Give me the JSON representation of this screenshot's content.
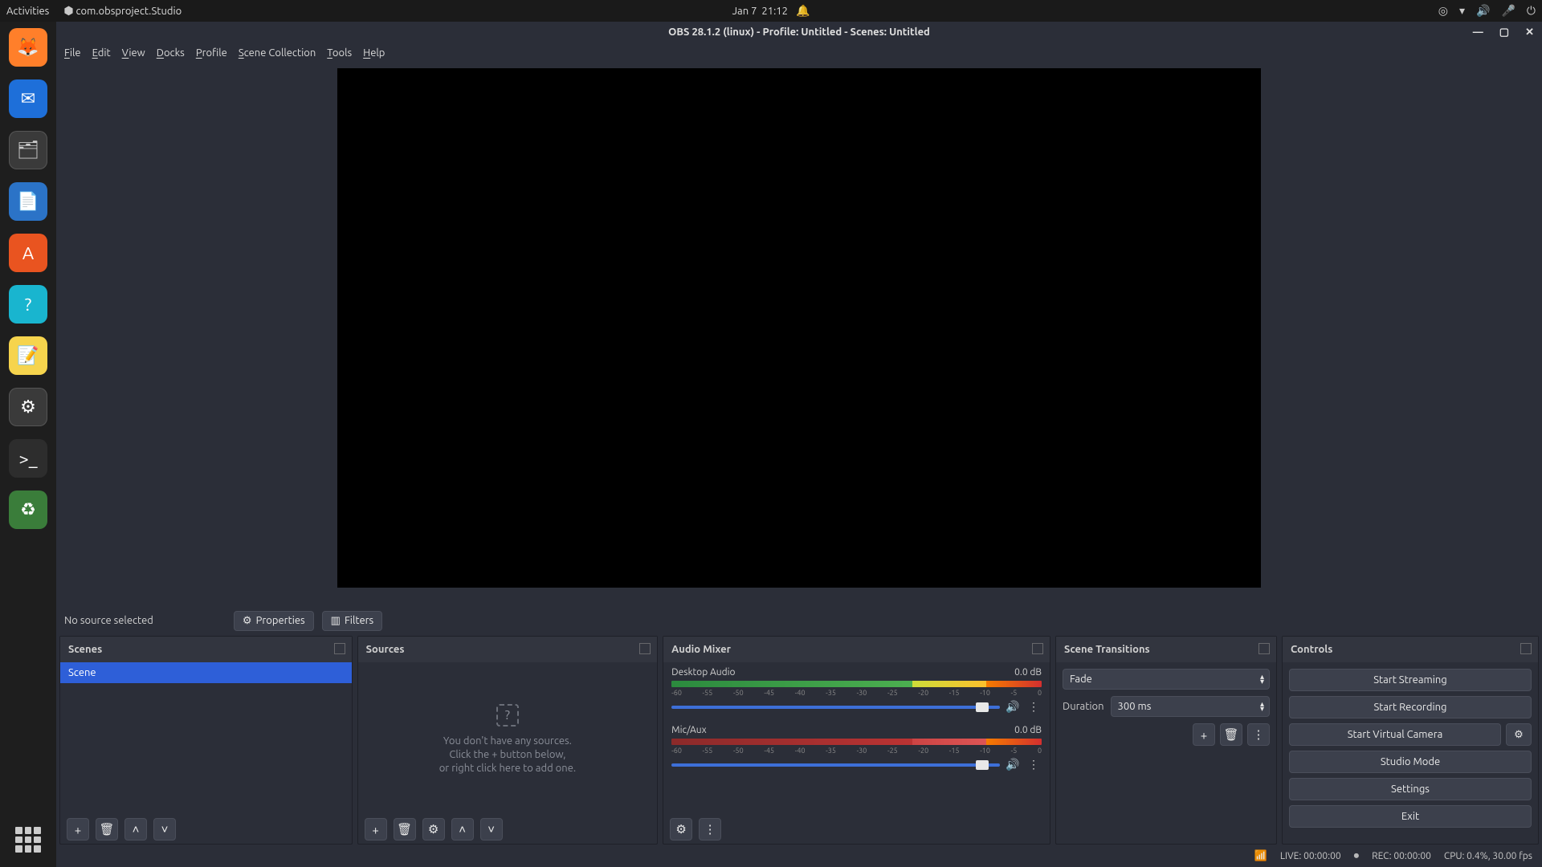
{
  "topbar": {
    "activities": "Activities",
    "app": "com.obsproject.Studio",
    "date": "Jan 7",
    "time": "21:12"
  },
  "window": {
    "title": "OBS 28.1.2 (linux) - Profile: Untitled - Scenes: Untitled"
  },
  "menubar": [
    "File",
    "Edit",
    "View",
    "Docks",
    "Profile",
    "Scene Collection",
    "Tools",
    "Help"
  ],
  "srcinfo": {
    "no_source": "No source selected",
    "properties": "Properties",
    "filters": "Filters"
  },
  "panels": {
    "scenes": {
      "title": "Scenes",
      "items": [
        "Scene"
      ]
    },
    "sources": {
      "title": "Sources",
      "empty_line1": "You don't have any sources.",
      "empty_line2": "Click the + button below,",
      "empty_line3": "or right click here to add one."
    },
    "mixer": {
      "title": "Audio Mixer",
      "tracks": [
        {
          "name": "Desktop Audio",
          "level": "0.0 dB"
        },
        {
          "name": "Mic/Aux",
          "level": "0.0 dB"
        }
      ],
      "ticks": [
        "-60",
        "-55",
        "-50",
        "-45",
        "-40",
        "-35",
        "-30",
        "-25",
        "-20",
        "-15",
        "-10",
        "-5",
        "0"
      ]
    },
    "transitions": {
      "title": "Scene Transitions",
      "transition": "Fade",
      "duration_label": "Duration",
      "duration_value": "300 ms"
    },
    "controls": {
      "title": "Controls",
      "start_streaming": "Start Streaming",
      "start_recording": "Start Recording",
      "start_virtual_camera": "Start Virtual Camera",
      "studio_mode": "Studio Mode",
      "settings": "Settings",
      "exit": "Exit"
    }
  },
  "status": {
    "live": "LIVE: 00:00:00",
    "rec": "REC: 00:00:00",
    "cpu": "CPU: 0.4%, 30.00 fps"
  }
}
